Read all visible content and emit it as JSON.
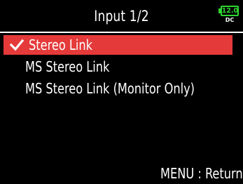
{
  "screen": {
    "title": "Input 1/2",
    "battery": {
      "voltage": "12.0",
      "source": "DC",
      "color": "#2fd52f"
    }
  },
  "menu": {
    "items": [
      {
        "label": "Stereo Link",
        "selected": true,
        "checked": true
      },
      {
        "label": "MS Stereo Link",
        "selected": false,
        "checked": false
      },
      {
        "label": "MS Stereo Link (Monitor Only)",
        "selected": false,
        "checked": false
      }
    ],
    "highlight_color": "#e53a3a"
  },
  "footer": {
    "hint": "MENU : Return"
  },
  "icons": {
    "check": "checkmark-icon",
    "battery": "battery-icon"
  }
}
